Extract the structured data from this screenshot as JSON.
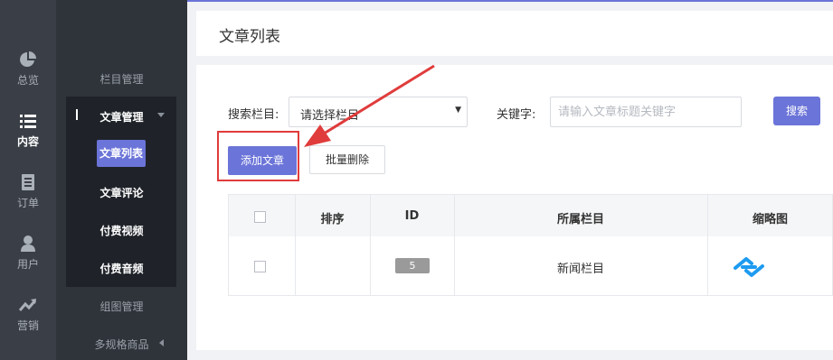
{
  "sidebar_primary": {
    "items": [
      {
        "label": "总览",
        "icon": "pie-chart-icon"
      },
      {
        "label": "内容",
        "icon": "list-icon",
        "active": true
      },
      {
        "label": "订单",
        "icon": "document-icon"
      },
      {
        "label": "用户",
        "icon": "user-icon"
      },
      {
        "label": "营销",
        "icon": "trend-icon"
      }
    ]
  },
  "sidebar_secondary": {
    "category_mgmt": "栏目管理",
    "article_mgmt": "文章管理",
    "article_list": "文章列表",
    "article_comments": "文章评论",
    "paid_video": "付费视频",
    "paid_audio": "付费音频",
    "gallery_mgmt": "组图管理",
    "multi_spec": "多规格商品"
  },
  "header": {
    "title": "文章列表"
  },
  "filters": {
    "category_label": "搜索栏目:",
    "category_value": "请选择栏目",
    "keyword_label": "关键字:",
    "keyword_placeholder": "请输入文章标题关键字",
    "search_button": "搜索"
  },
  "actions": {
    "add_button": "添加文章",
    "bulk_delete_button": "批量删除"
  },
  "table": {
    "columns": [
      "排序",
      "ID",
      "所属栏目",
      "缩略图"
    ],
    "rows": [
      {
        "sort": "",
        "id": "5",
        "category": "新闻栏目",
        "thumbnail": "logo-thumbnail"
      }
    ]
  },
  "colors": {
    "accent": "#6b74d8",
    "highlight": "#e03c3c",
    "sidebar_dark": "#3a3f47",
    "thumbnail_blue": "#1e9bf0"
  }
}
